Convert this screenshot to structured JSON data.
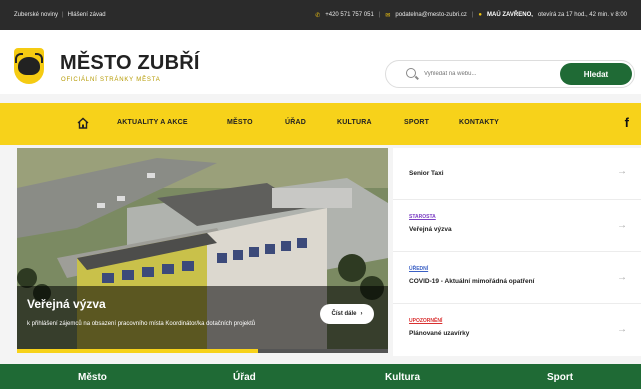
{
  "topbar": {
    "links": [
      "Zuberské noviny",
      "Hlášení závad"
    ],
    "phone": "+420 571 757 051",
    "email": "podatelna@mesto-zubri.cz",
    "hours_label": "MAÚ ZAVŘENO,",
    "hours_text": "otevírá za 17 hod., 42 min. v 8:00"
  },
  "header": {
    "title": "MĚSTO ZUBŘÍ",
    "subtitle": "OFICIÁLNÍ STRÁNKY MĚSTA",
    "search_placeholder": "Vyhledat na webu...",
    "search_button": "Hledat"
  },
  "nav": {
    "items": [
      "AKTUALITY A AKCE",
      "MĚSTO",
      "ÚŘAD",
      "KULTURA",
      "SPORT",
      "KONTAKTY"
    ],
    "facebook": "f"
  },
  "hero": {
    "title": "Veřejná výzva",
    "text": "k přihlášení zájemců na obsazení pracovního místa Koordinátor/ka dotačních projektů",
    "button": "Číst dále",
    "progress": 0.65
  },
  "news": [
    {
      "tag": "",
      "tag_color": "",
      "title": "Senior Taxi"
    },
    {
      "tag": "STAROSTA",
      "tag_color": "#7b3fc4",
      "title": "Veřejná výzva"
    },
    {
      "tag": "ÚŘEDNÍ",
      "tag_color": "#3a5fc4",
      "title": "COVID-19 - Aktuální mimořádná opatření"
    },
    {
      "tag": "UPOZORNĚNÍ",
      "tag_color": "#d93030",
      "title": "Plánované uzavírky"
    }
  ],
  "bottom_nav": [
    "Město",
    "Úřad",
    "Kultura",
    "Sport"
  ],
  "colors": {
    "primary_green": "#1f6a35",
    "accent_yellow": "#f7d21a",
    "topbar": "#2b2b2b"
  }
}
